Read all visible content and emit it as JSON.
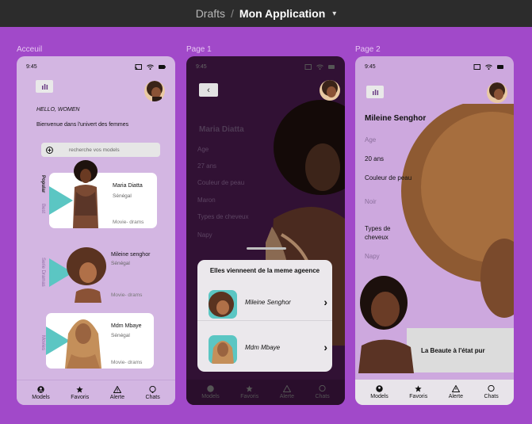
{
  "header": {
    "breadcrumb_root": "Drafts",
    "separator": "/",
    "project": "Mon Application"
  },
  "frames": {
    "p1": "Acceuil",
    "p2": "Page 1",
    "p3": "Page 2"
  },
  "status": {
    "time": "9:45"
  },
  "tabs": [
    "Models",
    "Favoris",
    "Alerte",
    "Chats"
  ],
  "home": {
    "hello": "HELLO, WOMEN",
    "welcome": "Bienvenue dans l'univert des femmes",
    "search_placeholder": "recherche vos models",
    "categories": [
      "Popular",
      "Best",
      "Serie Dramas",
      "Movies"
    ],
    "models": [
      {
        "name": "Maria Diatta",
        "country": "Sénégal",
        "genre": "Movie- drams"
      },
      {
        "name": "Mileine senghor",
        "country": "Sénégal",
        "genre": "Movie- drams"
      },
      {
        "name": "Mdm Mbaye",
        "country": "Sénégal",
        "genre": "Movie- drams"
      }
    ]
  },
  "detail": {
    "name": "Maria Diatta",
    "age_label": "Age",
    "age_value": "27 ans",
    "skin_label": "Couleur de peau",
    "skin_value": "Maron",
    "hair_label": "Types de cheveux",
    "hair_value": "Napy",
    "sheet_title": "Elles vienneent de la meme ageence",
    "agency_models": [
      "Mileine Senghor",
      "Mdm Mbaye"
    ]
  },
  "profile": {
    "name": "Mileine Senghor",
    "age_label": "Age",
    "age_value": "20 ans",
    "skin_label": "Couleur de peau",
    "skin_value": "Noir",
    "hair_label": "Types de cheveux",
    "hair_value": "Napy",
    "tagline": "La Beaute à l'état pur"
  },
  "colors": {
    "canvas": "#a149c9",
    "accent_teal": "#5bc6c3",
    "dark_frame": "#311134"
  }
}
